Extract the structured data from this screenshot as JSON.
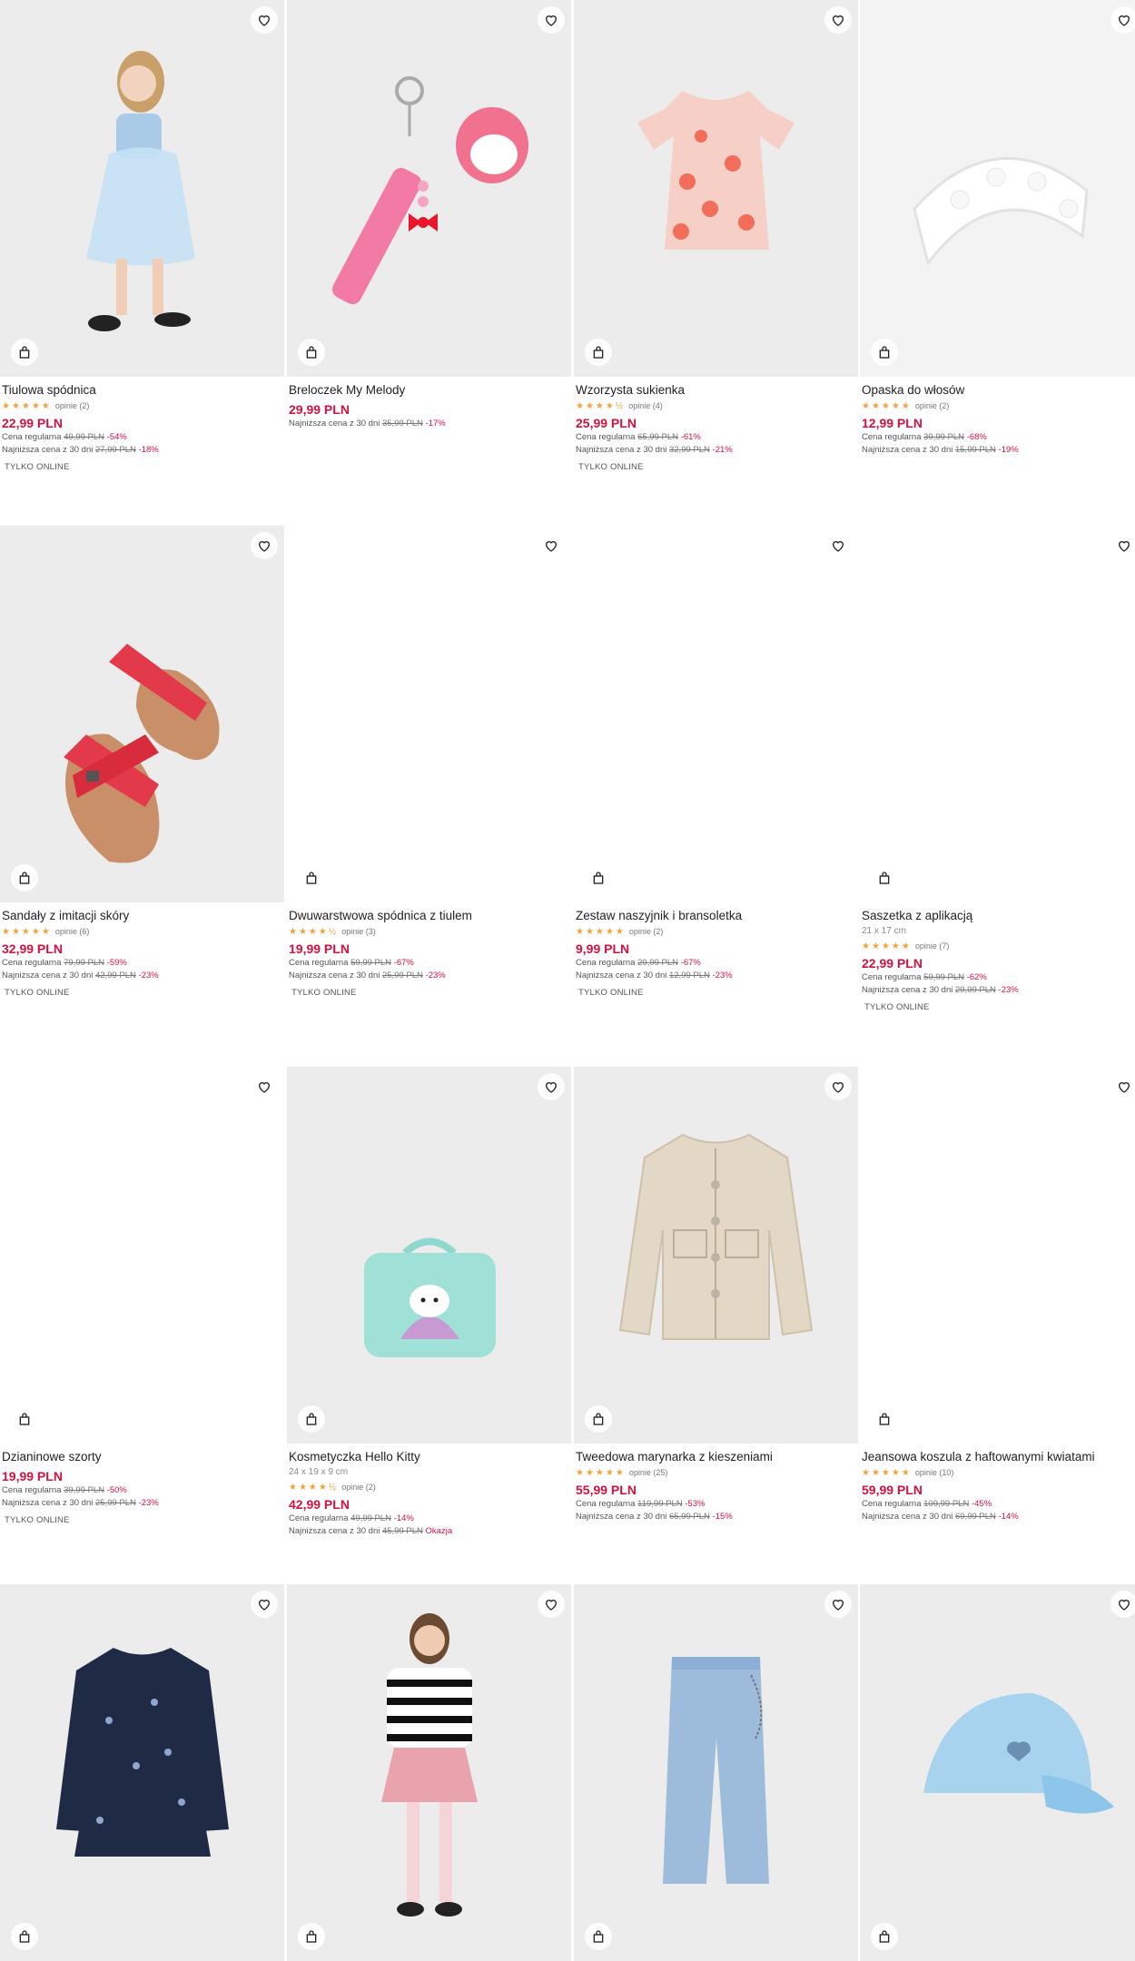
{
  "colors": {
    "price": "#d2123f",
    "star": "#f0a33a",
    "image_bg": "#ececec"
  },
  "icons": {
    "wishlist": "heart-icon",
    "add_to_cart": "shopping-bag-icon",
    "rating": "star-icon"
  },
  "products": [
    {
      "title": "Tiulowa spódnica",
      "stars": "★★★★★",
      "reviews": "opinie (2)",
      "price": "22,99 PLN",
      "regular_label": "Cena regularna",
      "regular_old": "49,99 PLN",
      "regular_disc": "-54%",
      "lowest_label": "Najniższa cena z 30 dni",
      "lowest_old": "27,99 PLN",
      "lowest_disc": "-18%",
      "badge": "TYLKO ONLINE"
    },
    {
      "title": "Breloczek My Melody",
      "price": "29,99 PLN",
      "lowest_label": "Najniższa cena z 30 dni",
      "lowest_old": "35,99 PLN",
      "lowest_disc": "-17%"
    },
    {
      "title": "Wzorzysta sukienka",
      "stars": "★★★★½",
      "reviews": "opinie (4)",
      "price": "25,99 PLN",
      "regular_label": "Cena regularna",
      "regular_old": "65,99 PLN",
      "regular_disc": "-61%",
      "lowest_label": "Najniższa cena z 30 dni",
      "lowest_old": "32,99 PLN",
      "lowest_disc": "-21%",
      "badge": "TYLKO ONLINE"
    },
    {
      "title": "Opaska do włosów",
      "stars": "★★★★★",
      "reviews": "opinie (2)",
      "price": "12,99 PLN",
      "regular_label": "Cena regularna",
      "regular_old": "39,99 PLN",
      "regular_disc": "-68%",
      "lowest_label": "Najniższa cena z 30 dni",
      "lowest_old": "15,99 PLN",
      "lowest_disc": "-19%"
    },
    {
      "title": "Sandały z imitacji skóry",
      "stars": "★★★★★",
      "reviews": "opinie (6)",
      "price": "32,99 PLN",
      "regular_label": "Cena regularna",
      "regular_old": "79,99 PLN",
      "regular_disc": "-59%",
      "lowest_label": "Najniższa cena z 30 dni",
      "lowest_old": "42,99 PLN",
      "lowest_disc": "-23%",
      "badge": "TYLKO ONLINE"
    },
    {
      "title": "Dwuwarstwowa spódnica z tiulem",
      "stars": "★★★★½",
      "reviews": "opinie (3)",
      "price": "19,99 PLN",
      "regular_label": "Cena regularna",
      "regular_old": "59,99 PLN",
      "regular_disc": "-67%",
      "lowest_label": "Najniższa cena z 30 dni",
      "lowest_old": "25,99 PLN",
      "lowest_disc": "-23%",
      "badge": "TYLKO ONLINE"
    },
    {
      "title": "Zestaw naszyjnik i bransoletka",
      "stars": "★★★★★",
      "reviews": "opinie (2)",
      "price": "9,99 PLN",
      "regular_label": "Cena regularna",
      "regular_old": "29,99 PLN",
      "regular_disc": "-67%",
      "lowest_label": "Najniższa cena z 30 dni",
      "lowest_old": "12,99 PLN",
      "lowest_disc": "-23%",
      "badge": "TYLKO ONLINE"
    },
    {
      "title": "Saszetka z aplikacją",
      "dims": "21 x 17 cm",
      "stars": "★★★★★",
      "reviews": "opinie (7)",
      "price": "22,99 PLN",
      "regular_label": "Cena regularna",
      "regular_old": "59,99 PLN",
      "regular_disc": "-62%",
      "lowest_label": "Najniższa cena z 30 dni",
      "lowest_old": "29,99 PLN",
      "lowest_disc": "-23%",
      "badge": "TYLKO ONLINE"
    },
    {
      "title": "Dzianinowe szorty",
      "price": "19,99 PLN",
      "regular_label": "Cena regularna",
      "regular_old": "39,99 PLN",
      "regular_disc": "-50%",
      "lowest_label": "Najniższa cena z 30 dni",
      "lowest_old": "25,99 PLN",
      "lowest_disc": "-23%",
      "badge": "TYLKO ONLINE"
    },
    {
      "title": "Kosmetyczka Hello Kitty",
      "dims": "24 x 19 x 9 cm",
      "stars": "★★★★½",
      "reviews": "opinie (2)",
      "price": "42,99 PLN",
      "regular_label": "Cena regularna",
      "regular_old": "49,99 PLN",
      "regular_disc": "-14%",
      "lowest_label": "Najniższa cena z 30 dni",
      "lowest_old": "45,99 PLN",
      "lowest_disc": "Okazja"
    },
    {
      "title": "Tweedowa marynarka z kieszeniami",
      "stars": "★★★★★",
      "reviews": "opinie (25)",
      "price": "55,99 PLN",
      "regular_label": "Cena regularna",
      "regular_old": "119,99 PLN",
      "regular_disc": "-53%",
      "lowest_label": "Najniższa cena z 30 dni",
      "lowest_old": "65,99 PLN",
      "lowest_disc": "-15%"
    },
    {
      "title": "Jeansowa koszula z haftowanymi kwiatami",
      "stars": "★★★★★",
      "reviews": "opinie (10)",
      "price": "59,99 PLN",
      "regular_label": "Cena regularna",
      "regular_old": "109,99 PLN",
      "regular_disc": "-45%",
      "lowest_label": "Najniższa cena z 30 dni",
      "lowest_old": "69,99 PLN",
      "lowest_disc": "-14%"
    },
    {
      "title": ""
    },
    {
      "title": ""
    },
    {
      "title": ""
    },
    {
      "title": ""
    }
  ]
}
